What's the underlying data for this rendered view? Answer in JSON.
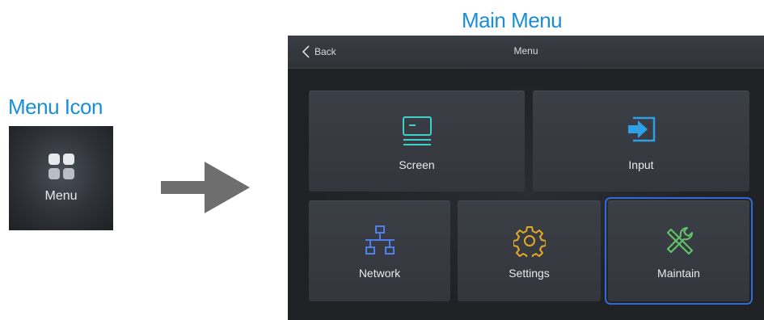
{
  "captions": {
    "menu_icon": "Menu Icon",
    "main_menu": "Main Menu"
  },
  "menu_icon_tile": {
    "label": "Menu",
    "icon": "grid-apps-icon"
  },
  "main_menu": {
    "topbar": {
      "back_label": "Back",
      "title": "Menu"
    },
    "tiles": [
      {
        "id": "screen",
        "label": "Screen",
        "icon": "screen-icon",
        "color": "#3fd0c9"
      },
      {
        "id": "input",
        "label": "Input",
        "icon": "input-icon",
        "color": "#2ea0e6"
      },
      {
        "id": "network",
        "label": "Network",
        "icon": "network-icon",
        "color": "#4f7fe8"
      },
      {
        "id": "settings",
        "label": "Settings",
        "icon": "gear-icon",
        "color": "#e5a826"
      },
      {
        "id": "maintain",
        "label": "Maintain",
        "icon": "tools-icon",
        "color": "#63c46a",
        "selected": true
      }
    ]
  },
  "colors": {
    "caption": "#1a8fd6",
    "selection_outline": "#2f6bd8"
  }
}
